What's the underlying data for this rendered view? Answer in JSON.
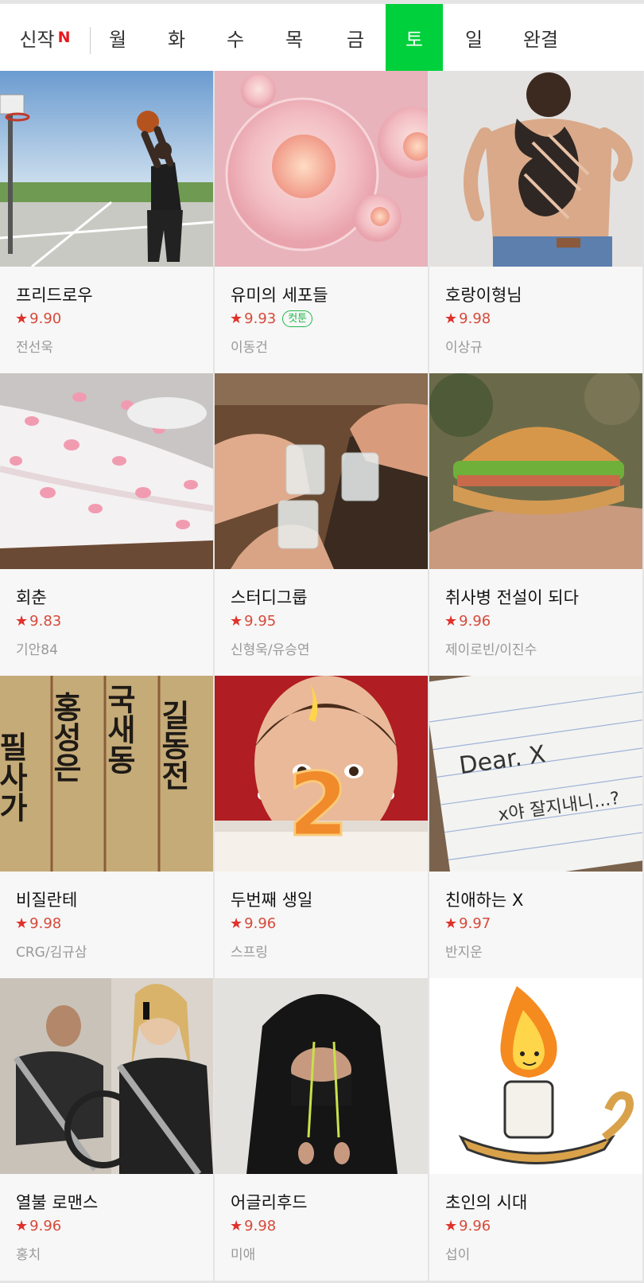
{
  "nav": {
    "new_label": "신작",
    "new_badge": "N",
    "days": [
      "월",
      "화",
      "수",
      "목",
      "금",
      "토",
      "일",
      "완결"
    ],
    "active_day": "토",
    "active_color": "#00d03b"
  },
  "rating_star": "★",
  "comics": [
    {
      "title": "프리드로우",
      "rating": "9.90",
      "author": "전선욱"
    },
    {
      "title": "유미의 세포들",
      "rating": "9.93",
      "author": "이동건",
      "badge": "컷툰"
    },
    {
      "title": "호랑이형님",
      "rating": "9.98",
      "author": "이상규"
    },
    {
      "title": "회춘",
      "rating": "9.83",
      "author": "기안84"
    },
    {
      "title": "스터디그룹",
      "rating": "9.95",
      "author": "신형욱/유승연"
    },
    {
      "title": "취사병 전설이 되다",
      "rating": "9.96",
      "author": "제이로빈/이진수"
    },
    {
      "title": "비질란테",
      "rating": "9.98",
      "author": "CRG/김규삼"
    },
    {
      "title": "두번째 생일",
      "rating": "9.96",
      "author": "스프링"
    },
    {
      "title": "친애하는 X",
      "rating": "9.97",
      "author": "반지운"
    },
    {
      "title": "열불 로맨스",
      "rating": "9.96",
      "author": "홍치"
    },
    {
      "title": "어글리후드",
      "rating": "9.98",
      "author": "미애"
    },
    {
      "title": "초인의 시대",
      "rating": "9.96",
      "author": "섭이"
    }
  ],
  "thumb_text": {
    "hanja_cols": [
      "필사가",
      "홍성은",
      "국새동",
      "길동전"
    ],
    "note_line1": "Dear. X",
    "note_line2": "x야 잘지내니...?",
    "candle_number": "2"
  }
}
